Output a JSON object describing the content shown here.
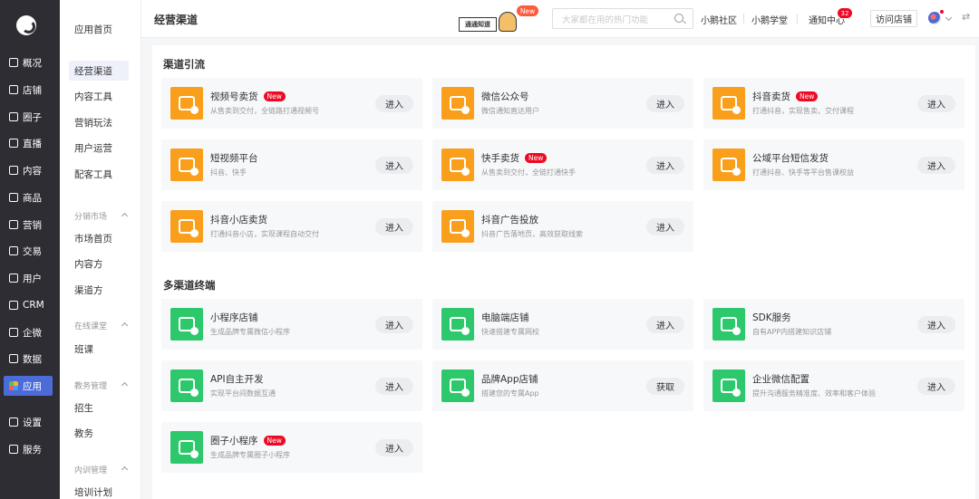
{
  "nav": {
    "items": [
      {
        "label": "概况",
        "icon": "overview-icon"
      },
      {
        "label": "店铺",
        "icon": "store-icon"
      },
      {
        "label": "圈子",
        "icon": "circle-icon"
      },
      {
        "label": "直播",
        "icon": "live-icon"
      },
      {
        "label": "内容",
        "icon": "content-icon"
      },
      {
        "label": "商品",
        "icon": "goods-icon"
      },
      {
        "label": "营销",
        "icon": "marketing-icon"
      },
      {
        "label": "交易",
        "icon": "trade-icon"
      },
      {
        "label": "用户",
        "icon": "user-icon"
      },
      {
        "label": "CRM",
        "icon": "crm-icon"
      },
      {
        "label": "企微",
        "icon": "wecom-icon"
      },
      {
        "label": "数据",
        "icon": "data-icon"
      },
      {
        "label": "应用",
        "icon": "apps-icon"
      },
      {
        "label": "设置",
        "icon": "settings-icon"
      },
      {
        "label": "服务",
        "icon": "service-icon"
      }
    ]
  },
  "subnav": {
    "top": [
      "应用首页",
      "经营渠道",
      "内容工具",
      "营销玩法",
      "用户运营",
      "配客工具"
    ],
    "groups": [
      {
        "title": "分销市场",
        "items": [
          "市场首页",
          "内容方",
          "渠道方"
        ]
      },
      {
        "title": "在线课堂",
        "items": [
          "班课"
        ]
      },
      {
        "title": "教务管理",
        "items": [
          "招生",
          "教务"
        ]
      },
      {
        "title": "内训管理",
        "items": [
          "培训计划"
        ]
      }
    ]
  },
  "header": {
    "title": "经营渠道",
    "promo_board": "通通知道",
    "promo_badge": "New",
    "search_placeholder": "大家都在用的热门功能",
    "links": [
      "小鹅社区",
      "小鹅学堂",
      "通知中心"
    ],
    "notify_count": "32",
    "visit_store": "访问店铺",
    "swap_symbol": "⇄"
  },
  "sections": [
    {
      "title": "渠道引流",
      "cards": [
        {
          "name": "视频号卖货",
          "desc": "从售卖到交付，全链路打通视频号",
          "new": "New",
          "action": "进入",
          "color": "orange"
        },
        {
          "name": "微信公众号",
          "desc": "微信通知直达用户",
          "new": "",
          "action": "进入",
          "color": "orange"
        },
        {
          "name": "抖音卖货",
          "desc": "打通抖音，实现售卖、交付课程",
          "new": "New",
          "action": "进入",
          "color": "orange"
        },
        {
          "name": "短视频平台",
          "desc": "抖音、快手",
          "new": "",
          "action": "进入",
          "color": "orange"
        },
        {
          "name": "快手卖货",
          "desc": "从售卖到交付，全链打通快手",
          "new": "New",
          "action": "进入",
          "color": "orange"
        },
        {
          "name": "公域平台短信发货",
          "desc": "打通抖音、快手等平台售课权益",
          "new": "",
          "action": "进入",
          "color": "orange"
        },
        {
          "name": "抖音小店卖货",
          "desc": "打通抖音小店，实现课程自动交付",
          "new": "",
          "action": "进入",
          "color": "orange"
        },
        {
          "name": "抖音广告投放",
          "desc": "抖音广告落地页，高效获取线索",
          "new": "",
          "action": "进入",
          "color": "orange"
        }
      ]
    },
    {
      "title": "多渠道终端",
      "cards": [
        {
          "name": "小程序店铺",
          "desc": "生成品牌专属微信小程序",
          "new": "",
          "action": "进入",
          "color": "green"
        },
        {
          "name": "电脑端店铺",
          "desc": "快速搭建专属网校",
          "new": "",
          "action": "进入",
          "color": "green"
        },
        {
          "name": "SDK服务",
          "desc": "自有APP内搭建知识店铺",
          "new": "",
          "action": "进入",
          "color": "green"
        },
        {
          "name": "API自主开发",
          "desc": "实现平台间数据互通",
          "new": "",
          "action": "进入",
          "color": "green"
        },
        {
          "name": "品牌App店铺",
          "desc": "搭建您的专属App",
          "new": "",
          "action": "获取",
          "color": "green"
        },
        {
          "name": "企业微信配置",
          "desc": "提升沟通服务精准度、效率和客户体验",
          "new": "",
          "action": "进入",
          "color": "green"
        },
        {
          "name": "圈子小程序",
          "desc": "生成品牌专属圈子小程序",
          "new": "New",
          "action": "进入",
          "color": "green"
        }
      ]
    }
  ]
}
